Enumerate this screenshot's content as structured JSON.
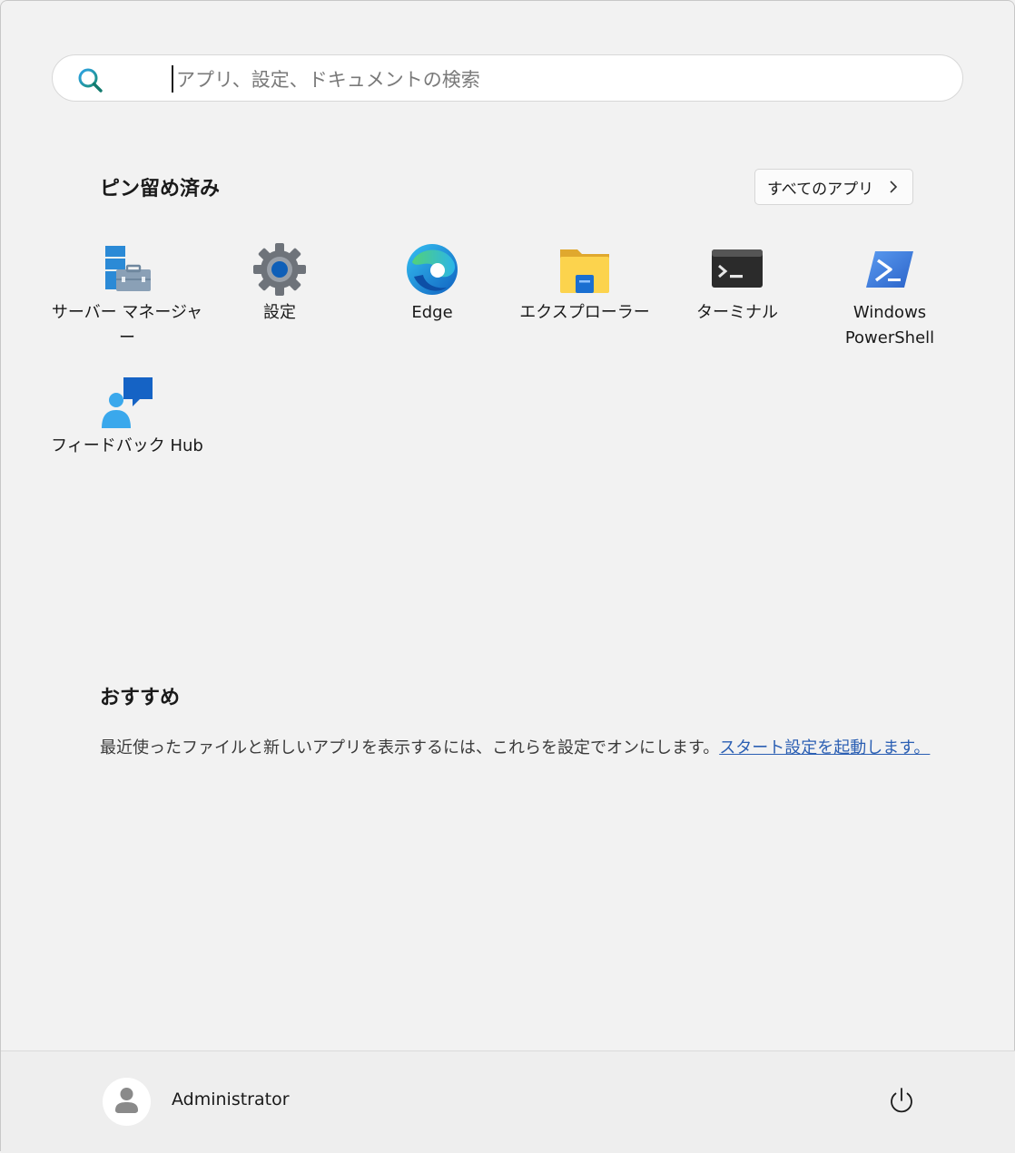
{
  "search": {
    "placeholder": "アプリ、設定、ドキュメントの検索"
  },
  "pinned": {
    "title": "ピン留め済み",
    "all_apps_label": "すべてのアプリ",
    "apps": [
      {
        "label": "サーバー マネージャー",
        "icon": "server-manager-icon"
      },
      {
        "label": "設定",
        "icon": "gear-icon"
      },
      {
        "label": "Edge",
        "icon": "edge-icon"
      },
      {
        "label": "エクスプローラー",
        "icon": "folder-icon"
      },
      {
        "label": "ターミナル",
        "icon": "terminal-icon"
      },
      {
        "label": "Windows\nPowerShell",
        "icon": "powershell-icon"
      },
      {
        "label": "フィードバック Hub",
        "icon": "feedback-hub-icon"
      }
    ]
  },
  "recommended": {
    "title": "おすすめ",
    "text": "最近使ったファイルと新しいアプリを表示するには、これらを設定でオンにします。",
    "link": "スタート設定を起動します。"
  },
  "footer": {
    "user_name": "Administrator"
  },
  "colors": {
    "accent": "#2b5fb3",
    "background": "#f2f2f2"
  }
}
